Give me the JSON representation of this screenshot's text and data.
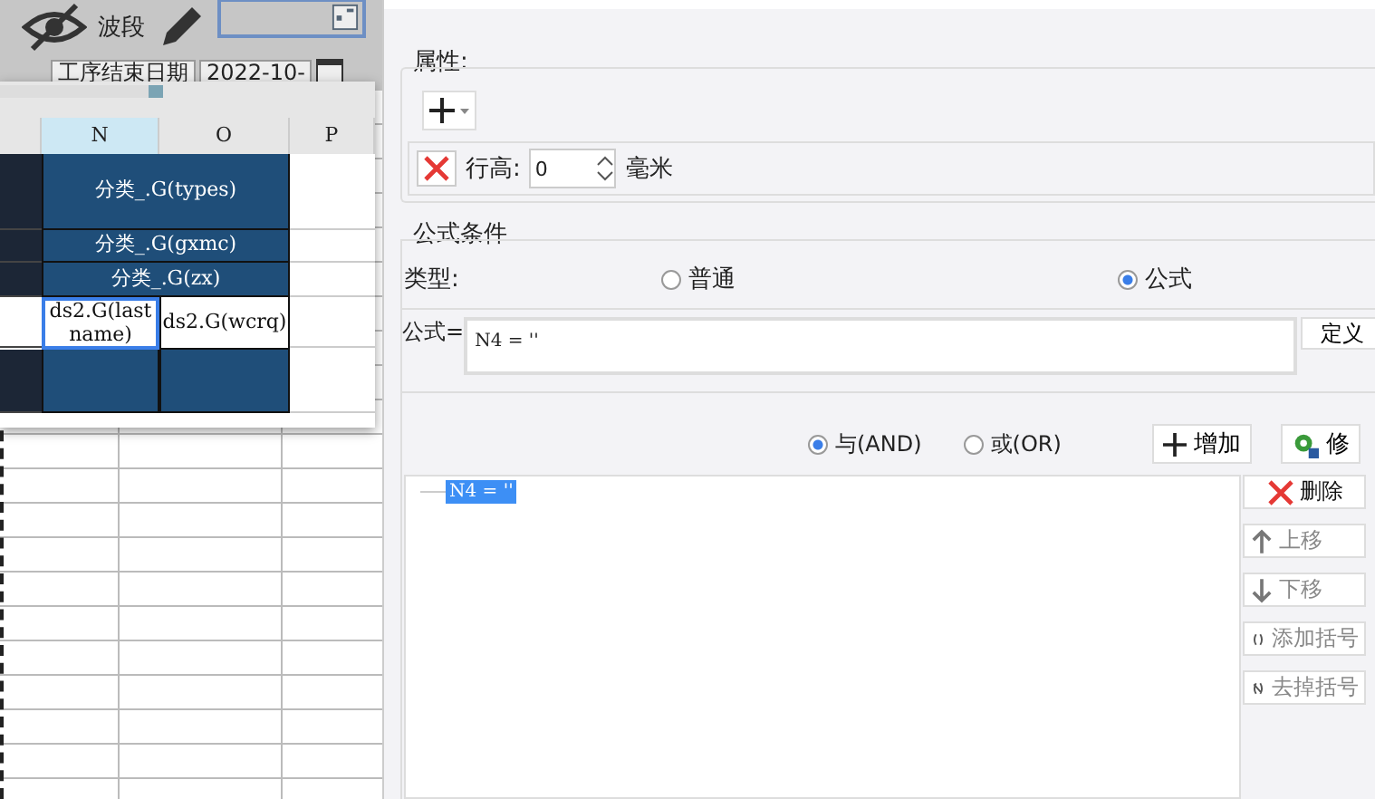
{
  "sheet": {
    "label": "波段",
    "date_label": "工序结束日期",
    "date_value": "2022-10-"
  },
  "preview": {
    "columns": [
      {
        "label": "N",
        "selected": true
      },
      {
        "label": "O",
        "selected": false
      },
      {
        "label": "P",
        "selected": false
      }
    ],
    "rows": [
      {
        "kind": "band",
        "cells": [
          {
            "text": "分类_.G(types)",
            "kind": "merged",
            "selected": false
          }
        ]
      },
      {
        "kind": "band",
        "cells": [
          {
            "text": "分类_.G(gxmc)",
            "kind": "merged",
            "selected": false
          }
        ]
      },
      {
        "kind": "band",
        "cells": [
          {
            "text": "分类_.G(zx)",
            "kind": "merged",
            "selected": false
          }
        ]
      },
      {
        "kind": "data",
        "cells": [
          {
            "text": "ds2.G(lastname)",
            "kind": "single",
            "selected": true
          },
          {
            "text": "ds2.G(wcrq)",
            "kind": "single",
            "selected": false
          }
        ]
      },
      {
        "kind": "band",
        "cells": [
          {
            "kind": "single",
            "selected": false
          },
          {
            "kind": "single",
            "selected": false
          }
        ]
      }
    ]
  },
  "properties": {
    "title": "属性:",
    "row_height_label": "行高:",
    "row_height_value": "0",
    "unit": "毫米"
  },
  "condition": {
    "title": "公式条件",
    "type_label": "类型:",
    "types": [
      {
        "label": "普通",
        "selected": false
      },
      {
        "label": "公式",
        "selected": true
      }
    ],
    "formula_label": "公式=",
    "formula": "N4 = ''",
    "define_button": "定义",
    "logic": [
      {
        "label": "与(AND)",
        "selected": true
      },
      {
        "label": "或(OR)",
        "selected": false
      }
    ],
    "add_button": "增加",
    "edit_button": "修",
    "conditions": [
      {
        "text": "N4 = ''",
        "selected": true
      }
    ],
    "actions": [
      {
        "label": "删除",
        "kind": "delete",
        "disabled": false
      },
      {
        "label": "上移",
        "kind": "up",
        "disabled": true
      },
      {
        "label": "下移",
        "kind": "down",
        "disabled": true
      },
      {
        "label": "添加括号",
        "kind": "bracket",
        "disabled": true
      },
      {
        "label": "去掉括号",
        "kind": "unbracket",
        "disabled": true
      }
    ]
  }
}
